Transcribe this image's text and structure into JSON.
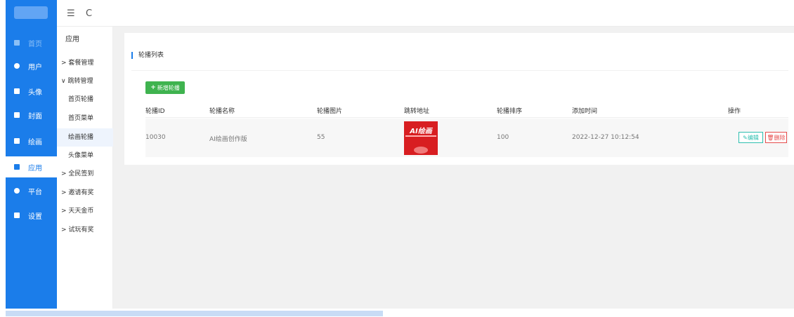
{
  "topbar": {
    "menu_icon": "☰",
    "refresh_icon": "C"
  },
  "sidebar": {
    "items": [
      {
        "label": "首页",
        "icon": "dashboard-icon"
      },
      {
        "label": "用户",
        "icon": "user-icon"
      },
      {
        "label": "头像",
        "icon": "avatar-icon"
      },
      {
        "label": "封面",
        "icon": "cover-icon"
      },
      {
        "label": "绘画",
        "icon": "paint-icon"
      },
      {
        "label": "应用",
        "icon": "app-icon"
      },
      {
        "label": "平台",
        "icon": "platform-icon"
      },
      {
        "label": "设置",
        "icon": "settings-icon"
      }
    ]
  },
  "submenu": {
    "title": "应用",
    "items": [
      {
        "label": "> 套餐管理"
      },
      {
        "label": "∨ 跳转管理"
      },
      {
        "label": "首页轮播"
      },
      {
        "label": "首页菜单"
      },
      {
        "label": "绘画轮播"
      },
      {
        "label": "头像菜单"
      },
      {
        "label": "> 全民签到"
      },
      {
        "label": "> 邀请有奖"
      },
      {
        "label": "> 天天金币"
      },
      {
        "label": "> 试玩有奖"
      }
    ]
  },
  "panel": {
    "title": "轮播列表",
    "add_button": "新增轮播",
    "columns": [
      "轮播ID",
      "轮播名称",
      "轮播图片",
      "跳转地址",
      "轮播排序",
      "添加时间",
      "操作"
    ],
    "rows": [
      {
        "id": "10030",
        "name": "AI绘画创作版",
        "image": "55",
        "thumb_title": "AI绘画",
        "sort": "100",
        "added": "2022-12-27 10:12:54",
        "edit": "编辑",
        "delete": "删除"
      }
    ]
  },
  "colors": {
    "primary": "#1b7dea",
    "add_green": "#3fb34f",
    "edit_teal": "#2ebfb0",
    "delete_red": "#e64c4c",
    "thumb_red": "#d81e21"
  }
}
